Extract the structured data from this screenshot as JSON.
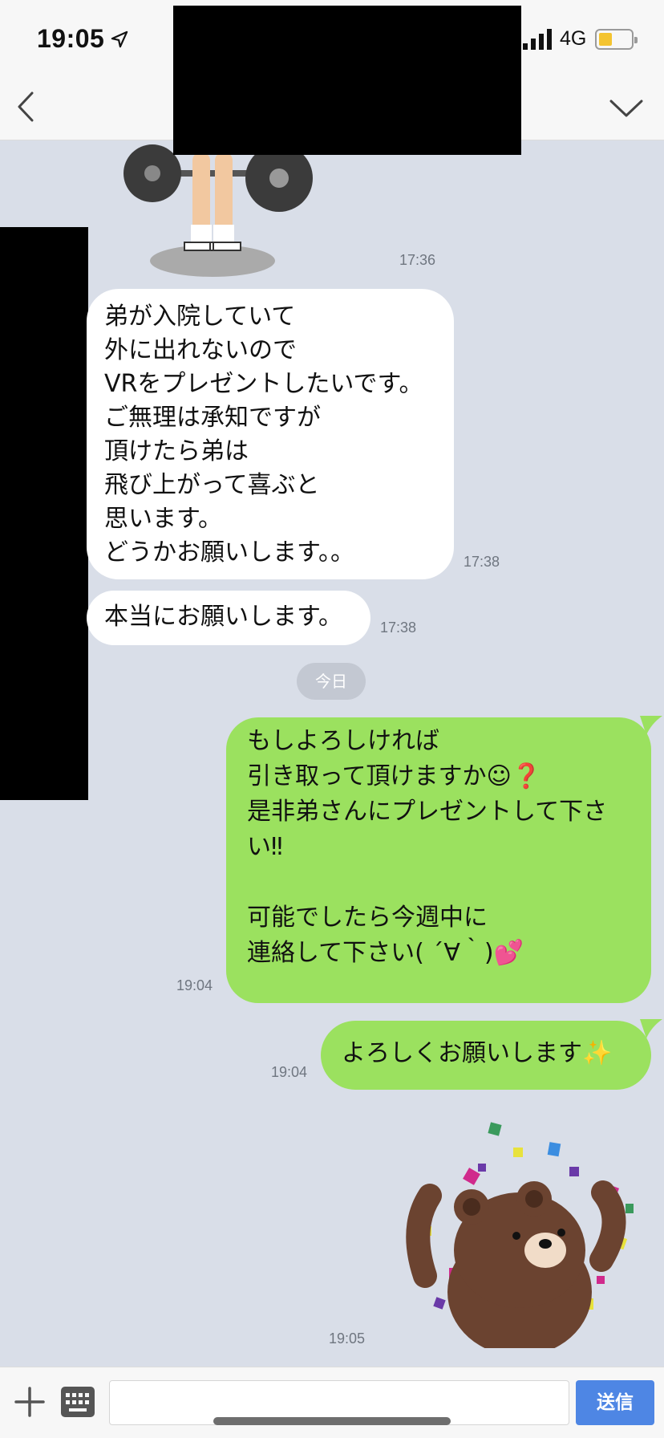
{
  "status_bar": {
    "time": "19:05",
    "network": "4G"
  },
  "messages": {
    "sticker_1_time": "17:36",
    "in_1": {
      "text": "弟が入院していて\n外に出れないので\nVRをプレゼントしたいです。\nご無理は承知ですが\n頂けたら弟は\n飛び上がって喜ぶと\n思います。\nどうかお願いします。。",
      "time": "17:38"
    },
    "in_2": {
      "text": "本当にお願いします。",
      "time": "17:38"
    },
    "date_separator": "今日",
    "out_1": {
      "text": "もしよろしければ\n引き取って頂けますか☺❓\n是非弟さんにプレゼントして下さい‼\n\n可能でしたら今週中に\n連絡して下さい( ´∀｀)💕",
      "time": "19:04"
    },
    "out_2": {
      "text": "よろしくお願いします✨",
      "time": "19:04"
    },
    "sticker_2_time": "19:05"
  },
  "input_bar": {
    "placeholder": "",
    "send_label": "送信"
  },
  "colors": {
    "background": "#d9dee8",
    "outgoing_bubble": "#9be15f",
    "incoming_bubble": "#ffffff",
    "send_button": "#4e86e4"
  },
  "icons": {
    "back": "chevron-left-icon",
    "menu": "chevron-down-icon",
    "plus": "plus-icon",
    "keyboard": "keyboard-icon",
    "location": "location-arrow-icon"
  }
}
